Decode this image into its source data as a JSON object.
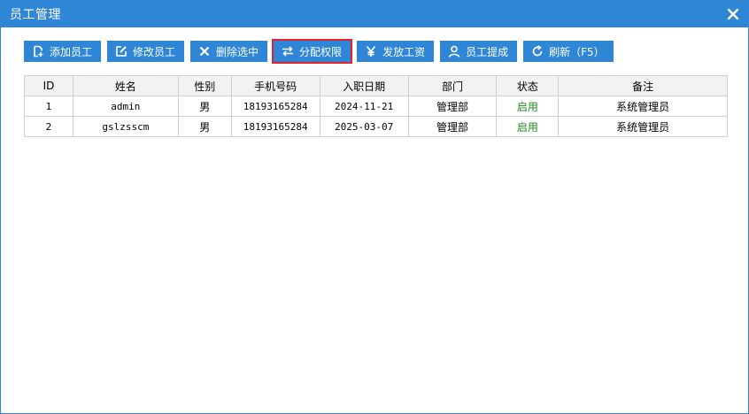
{
  "window": {
    "title": "员工管理"
  },
  "toolbar": {
    "buttons": [
      {
        "label": "添加员工",
        "icon": "add-document-icon"
      },
      {
        "label": "修改员工",
        "icon": "edit-icon"
      },
      {
        "label": "删除选中",
        "icon": "close-icon"
      },
      {
        "label": "分配权限",
        "icon": "sliders-icon"
      },
      {
        "label": "发放工资",
        "icon": "yen-icon"
      },
      {
        "label": "员工提成",
        "icon": "user-icon"
      },
      {
        "label": "刷新（F5）",
        "icon": "refresh-icon"
      }
    ],
    "selected_index": 3
  },
  "table": {
    "columns": [
      "ID",
      "姓名",
      "性别",
      "手机号码",
      "入职日期",
      "部门",
      "状态",
      "备注"
    ],
    "rows": [
      [
        "1",
        "admin",
        "男",
        "18193165284",
        "2024-11-21",
        "管理部",
        "启用",
        "系统管理员"
      ],
      [
        "2",
        "gslzsscm",
        "男",
        "18193165284",
        "2025-03-07",
        "管理部",
        "启用",
        "系统管理员"
      ]
    ]
  },
  "colors": {
    "accent": "#2f86d6",
    "status_enabled": "#1a8a1a",
    "highlight_border": "#e1232b"
  }
}
